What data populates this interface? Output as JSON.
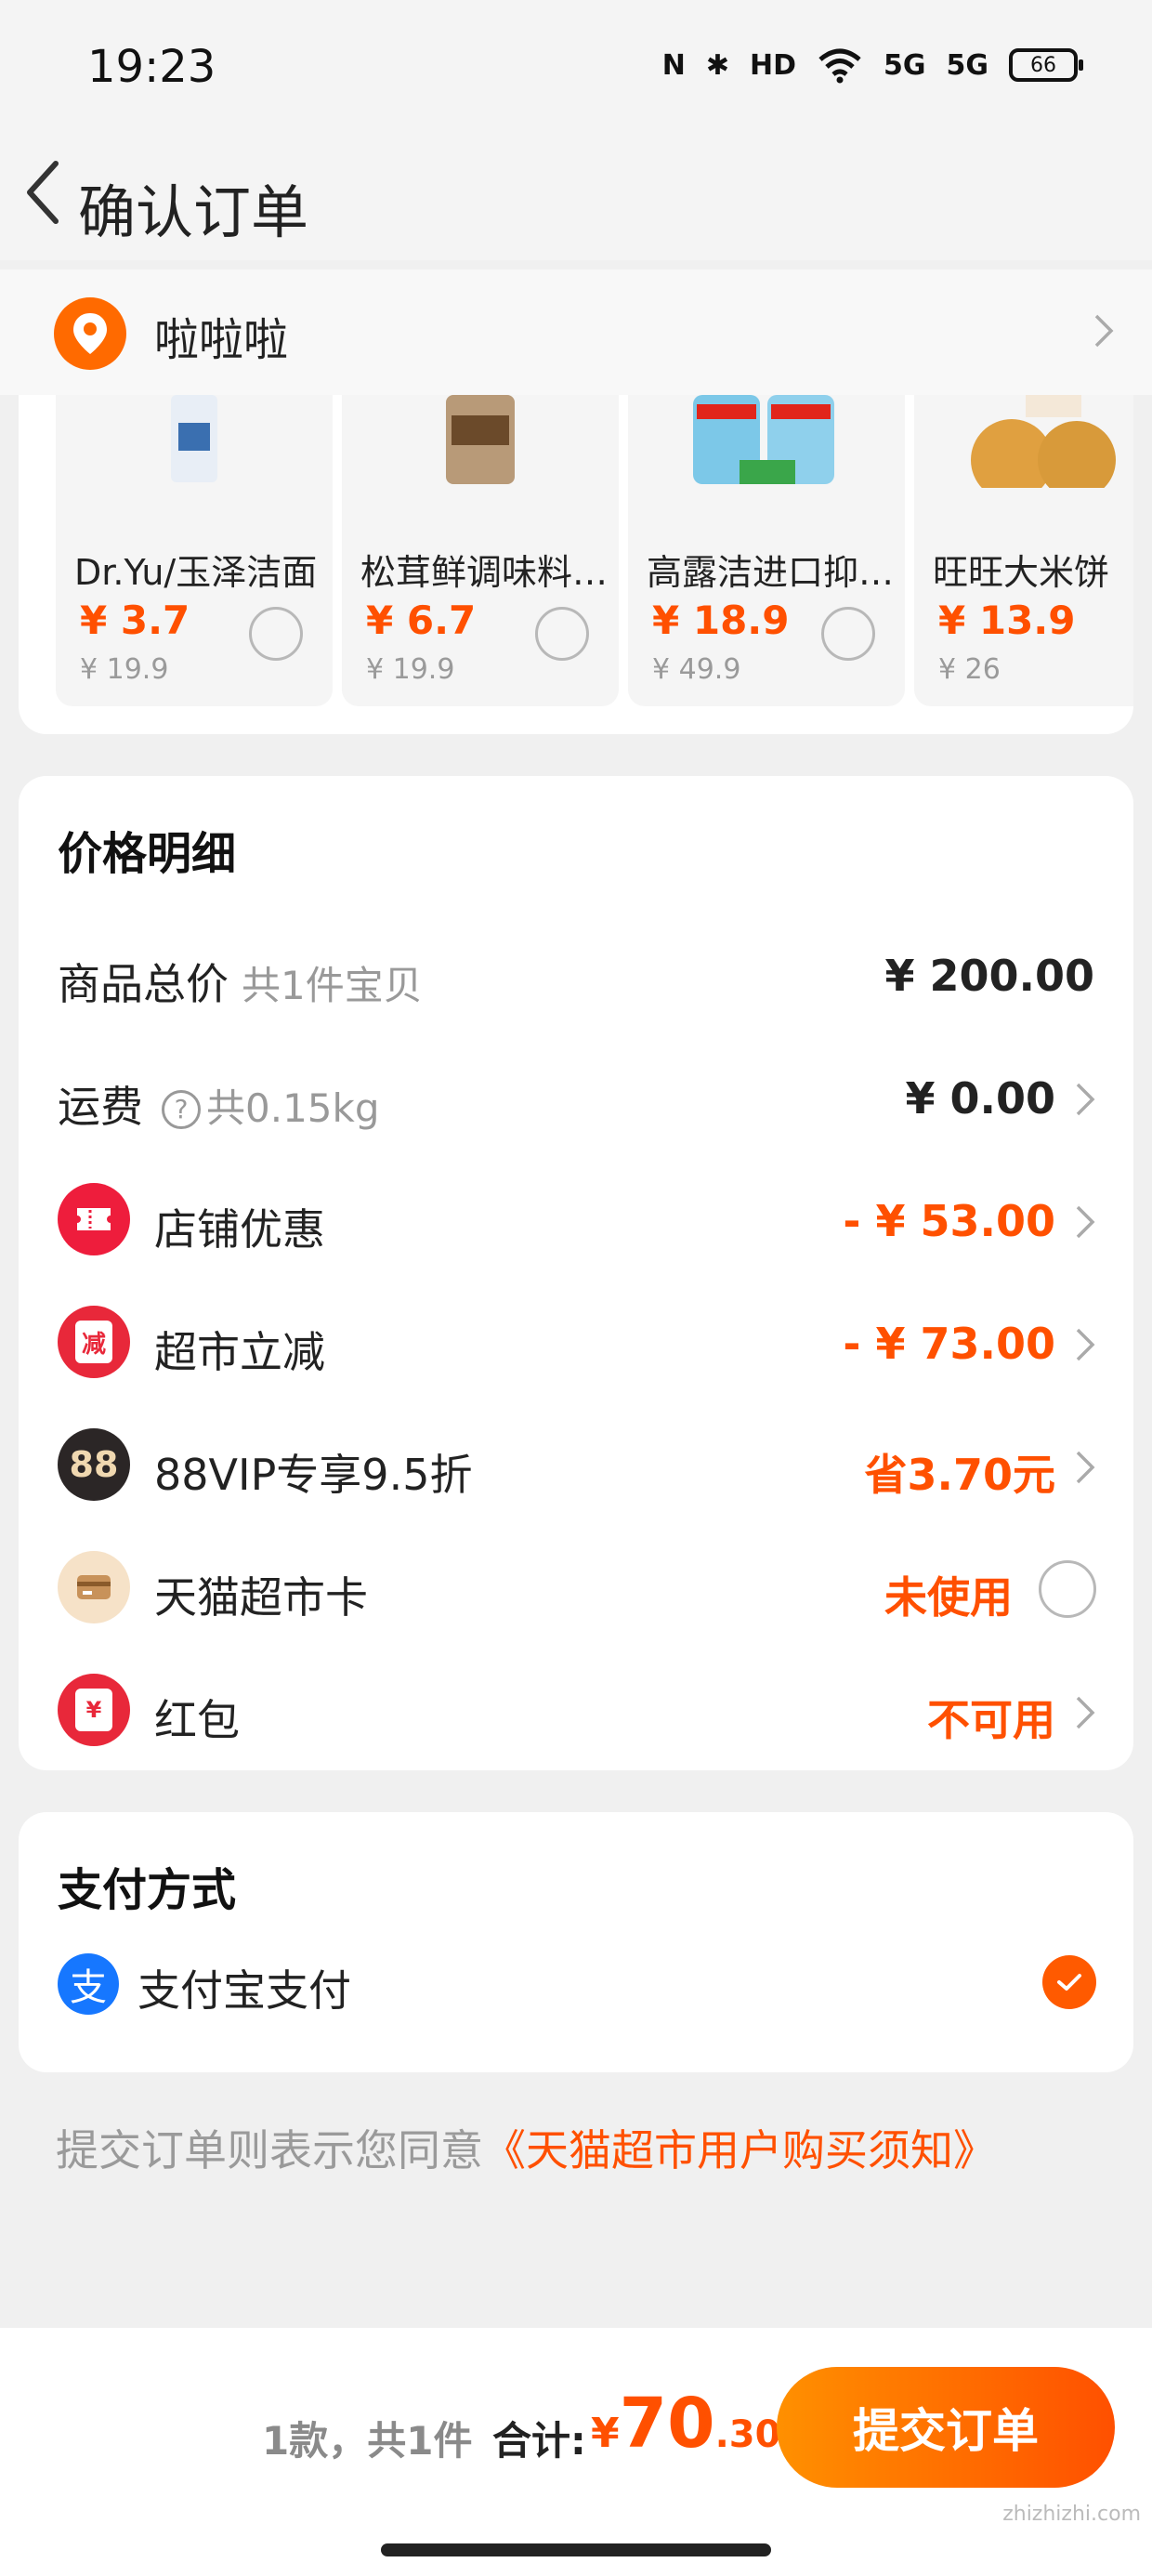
{
  "status_bar": {
    "time": "19:23",
    "nfc": "N",
    "bluetooth": "✱",
    "hd": "HD",
    "signal1": "5G",
    "signal2": "5G",
    "battery": "66"
  },
  "nav": {
    "title": "确认订单"
  },
  "address": {
    "text": "啦啦啦"
  },
  "goods": [
    {
      "name": "Dr.Yu/玉泽洁面",
      "price": "¥ 3.7",
      "orig": "¥ 19.9"
    },
    {
      "name": "松茸鲜调味料…",
      "price": "¥ 6.7",
      "orig": "¥ 19.9"
    },
    {
      "name": "高露洁进口抑…",
      "price": "¥ 18.9",
      "orig": "¥ 49.9"
    },
    {
      "name": "旺旺大米饼",
      "price": "¥ 13.9",
      "orig": "¥ 26"
    }
  ],
  "price_detail": {
    "title": "价格明细",
    "goods_total": {
      "label": "商品总价",
      "sub": "共1件宝贝",
      "value": "¥ 200.00"
    },
    "shipping": {
      "label": "运费",
      "qmark": "?",
      "sub": "共0.15kg",
      "value": "¥ 0.00"
    },
    "shop_discount": {
      "label": "店铺优惠",
      "value": "- ¥ 53.00"
    },
    "market_discount": {
      "label": "超市立减",
      "icon_text": "减",
      "value": "- ¥ 73.00"
    },
    "vip": {
      "label": "88VIP专享9.5折",
      "icon_text": "88",
      "value": "省3.70元"
    },
    "market_card": {
      "label": "天猫超市卡",
      "value": "未使用"
    },
    "red_packet": {
      "label": "红包",
      "icon_text": "¥",
      "value": "不可用"
    }
  },
  "payment": {
    "title": "支付方式",
    "icon_text": "支",
    "method": "支付宝支付"
  },
  "agreement": {
    "text": "提交订单则表示您同意",
    "link": "《天猫超市用户购买须知》"
  },
  "footer": {
    "count": "1款，共1件",
    "total_label": "合计:",
    "currency": "¥",
    "total_int": "70",
    "total_dec": ".30",
    "submit": "提交订单",
    "watermark": "zhizhizhi.com"
  },
  "colors": {
    "accent": "#ff5000",
    "gradient_start": "#ff9000",
    "alipay": "#1677ff"
  }
}
